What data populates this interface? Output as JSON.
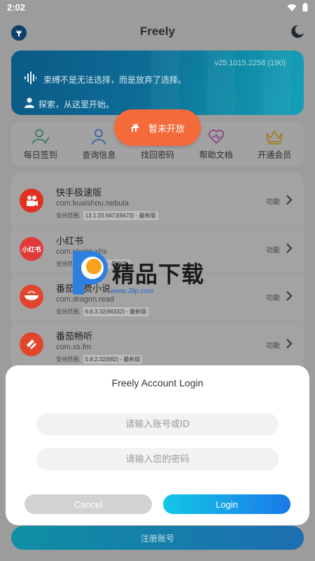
{
  "status_bar": {
    "time": "2:02"
  },
  "header": {
    "title": "Freely"
  },
  "banner": {
    "version": "v25.1015.2258 (190)",
    "quote": "束缚不是无法选择，而是放弃了选择。",
    "explore": "探索，从这里开始。"
  },
  "toast": {
    "text": "暂未开放"
  },
  "actions": [
    {
      "label": "每日签到",
      "icon": "check-user-icon"
    },
    {
      "label": "查询信息",
      "icon": "user-icon"
    },
    {
      "label": "找回密码",
      "icon": "key-icon"
    },
    {
      "label": "帮助文档",
      "icon": "heart-icon"
    },
    {
      "label": "开通会员",
      "icon": "crown-icon"
    }
  ],
  "apps": [
    {
      "name": "快手极速版",
      "pkg": "com.kuaishou.nebula",
      "support_label": "支持范围:",
      "support_ver": "13.1.20.9473(9473) - 最新版",
      "func": "功能",
      "icon_color": "#e0301e"
    },
    {
      "name": "小红书",
      "pkg": "com.xingin.xhs",
      "support_label": "支持范围:",
      "support_ver": "7.0(913) - 最新版",
      "func": "功能",
      "icon_color": "#e23a3a",
      "icon_text": "小红书"
    },
    {
      "name": "番茄免费小说",
      "pkg": "com.dragon.read",
      "support_label": "支持范围:",
      "support_ver": "6.6.3.32(66332) - 最新版",
      "func": "功能",
      "icon_color": "#e2452b"
    },
    {
      "name": "番茄畅听",
      "pkg": "com.xs.fm",
      "support_label": "支持范围:",
      "support_ver": "5.8.2.32(582) - 最新版",
      "func": "功能",
      "icon_color": "#e0472a"
    }
  ],
  "watermark": {
    "text": "精品下载",
    "url": "www.J9p.com"
  },
  "register": {
    "label": "注册账号"
  },
  "dialog": {
    "title": "Freely Account Login",
    "account_placeholder": "请输入账号或ID",
    "password_placeholder": "请输入您的密码",
    "cancel_label": "Cancel",
    "login_label": "Login"
  },
  "colors": {
    "accent": "#1a79e8",
    "toast": "#f56a3a",
    "banner": "#0d6c96"
  }
}
